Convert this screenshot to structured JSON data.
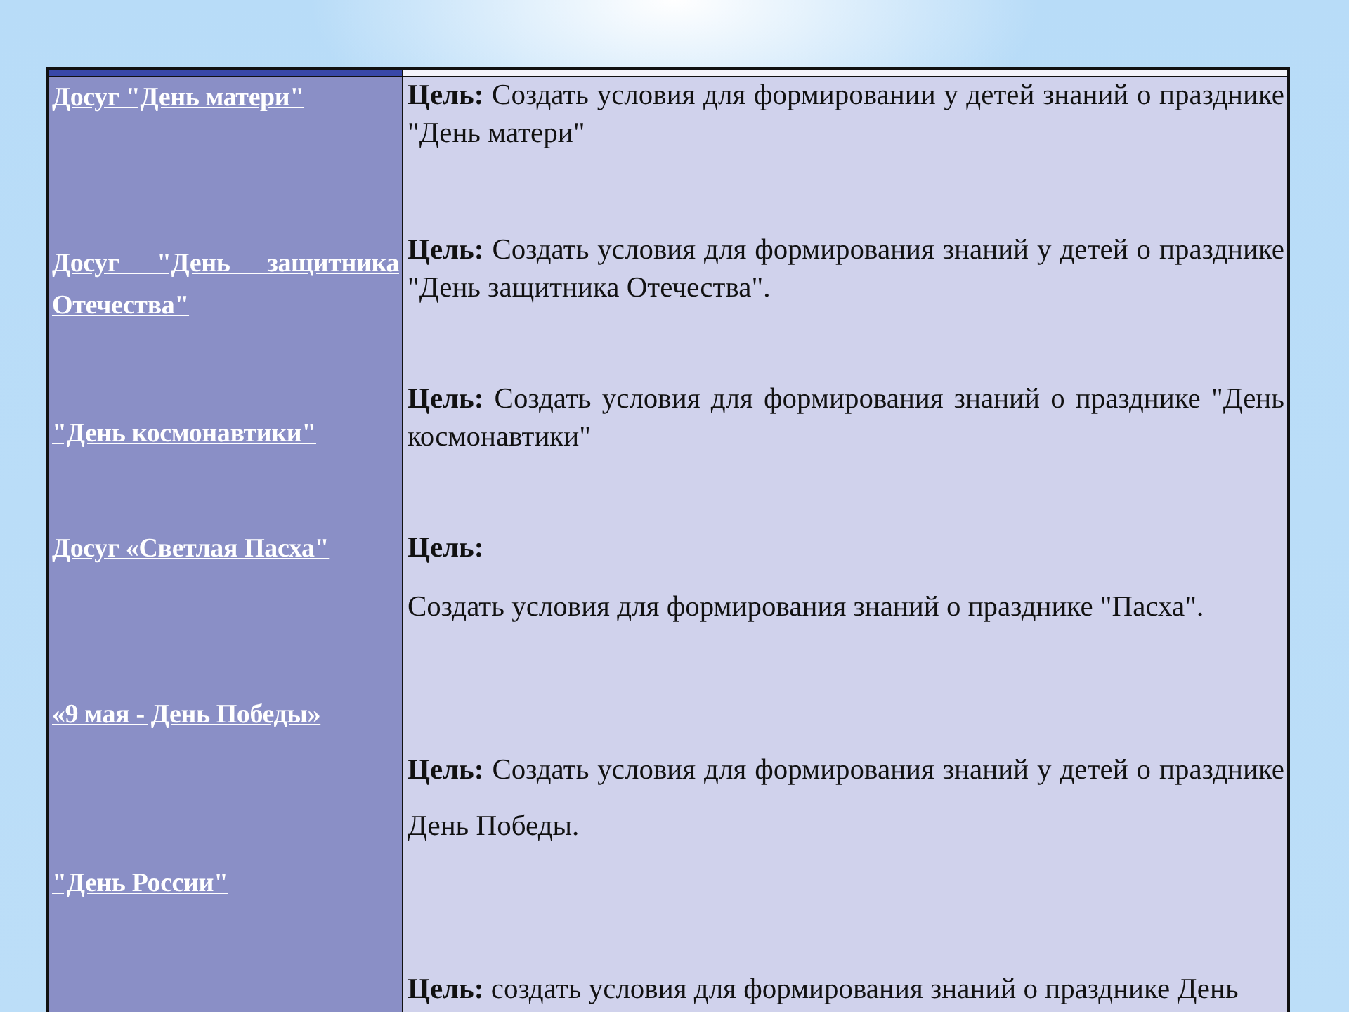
{
  "table": {
    "events": [
      {
        "title": "Досуг \"День матери\""
      },
      {
        "title": "Досуг \"День защитника Отечества\" "
      },
      {
        "title": "\"День космонавтики\""
      },
      {
        "title": "Досуг «Светлая Пасха\""
      },
      {
        "title": "«9 мая - День Победы»"
      },
      {
        "title": "\"День России\" "
      }
    ],
    "goals": [
      {
        "kind": "inline",
        "label": "Цель:",
        "text": "Создать условия для формировании у детей знаний о празднике \"День матери\""
      },
      {
        "kind": "inline",
        "label": "Цель:",
        "text": "Создать условия для формирования знаний у детей о празднике \"День защитника Отечества\"."
      },
      {
        "kind": "inline",
        "label": "Цель:",
        "text": "Создать условия для формирования знаний о празднике \"День космонавтики\""
      },
      {
        "kind": "stacked",
        "label": "Цель:",
        "text": "Создать условия для формирования знаний о празднике \"Пасха\"."
      },
      {
        "kind": "inline",
        "label": "Цель:",
        "text": "Создать условия для формирования знаний у детей о празднике День Победы."
      },
      {
        "kind": "inline",
        "label": "Цель:",
        "text": "создать условия для формирования знаний о празднике День"
      }
    ]
  }
}
